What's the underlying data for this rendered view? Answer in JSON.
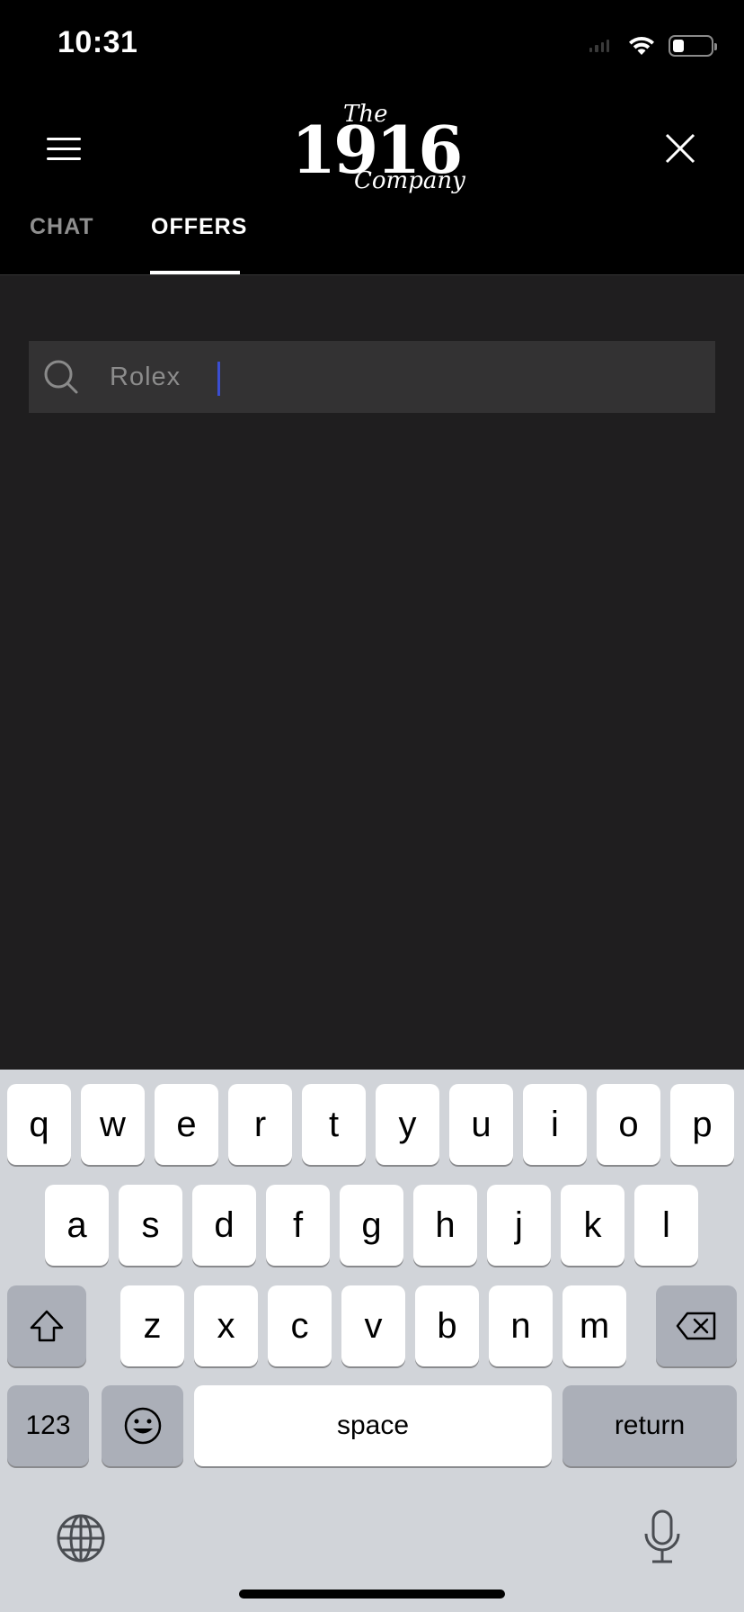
{
  "status_bar": {
    "time": "10:31",
    "battery_level": 0.3
  },
  "header": {
    "logo": {
      "the": "The",
      "year": "1916",
      "company": "Company"
    },
    "icons": {
      "menu": "hamburger-menu-icon",
      "close": "close-icon"
    }
  },
  "tabs": [
    {
      "label": "CHAT",
      "active": false
    },
    {
      "label": "OFFERS",
      "active": true
    }
  ],
  "search": {
    "value": "Rolex",
    "icon": "search-icon"
  },
  "keyboard": {
    "row1": [
      "q",
      "w",
      "e",
      "r",
      "t",
      "y",
      "u",
      "i",
      "o",
      "p"
    ],
    "row2": [
      "a",
      "s",
      "d",
      "f",
      "g",
      "h",
      "j",
      "k",
      "l"
    ],
    "row3": [
      "z",
      "x",
      "c",
      "v",
      "b",
      "n",
      "m"
    ],
    "numbers_label": "123",
    "space_label": "space",
    "return_label": "return",
    "icons": {
      "shift": "shift-icon",
      "delete": "backspace-icon",
      "emoji": "emoji-icon",
      "globe": "globe-icon",
      "mic": "microphone-icon"
    }
  },
  "colors": {
    "background": "#1f1e1f",
    "header": "#000000",
    "search_field": "#333233",
    "caret": "#3b4ed1",
    "keyboard": "#d1d4d9"
  }
}
